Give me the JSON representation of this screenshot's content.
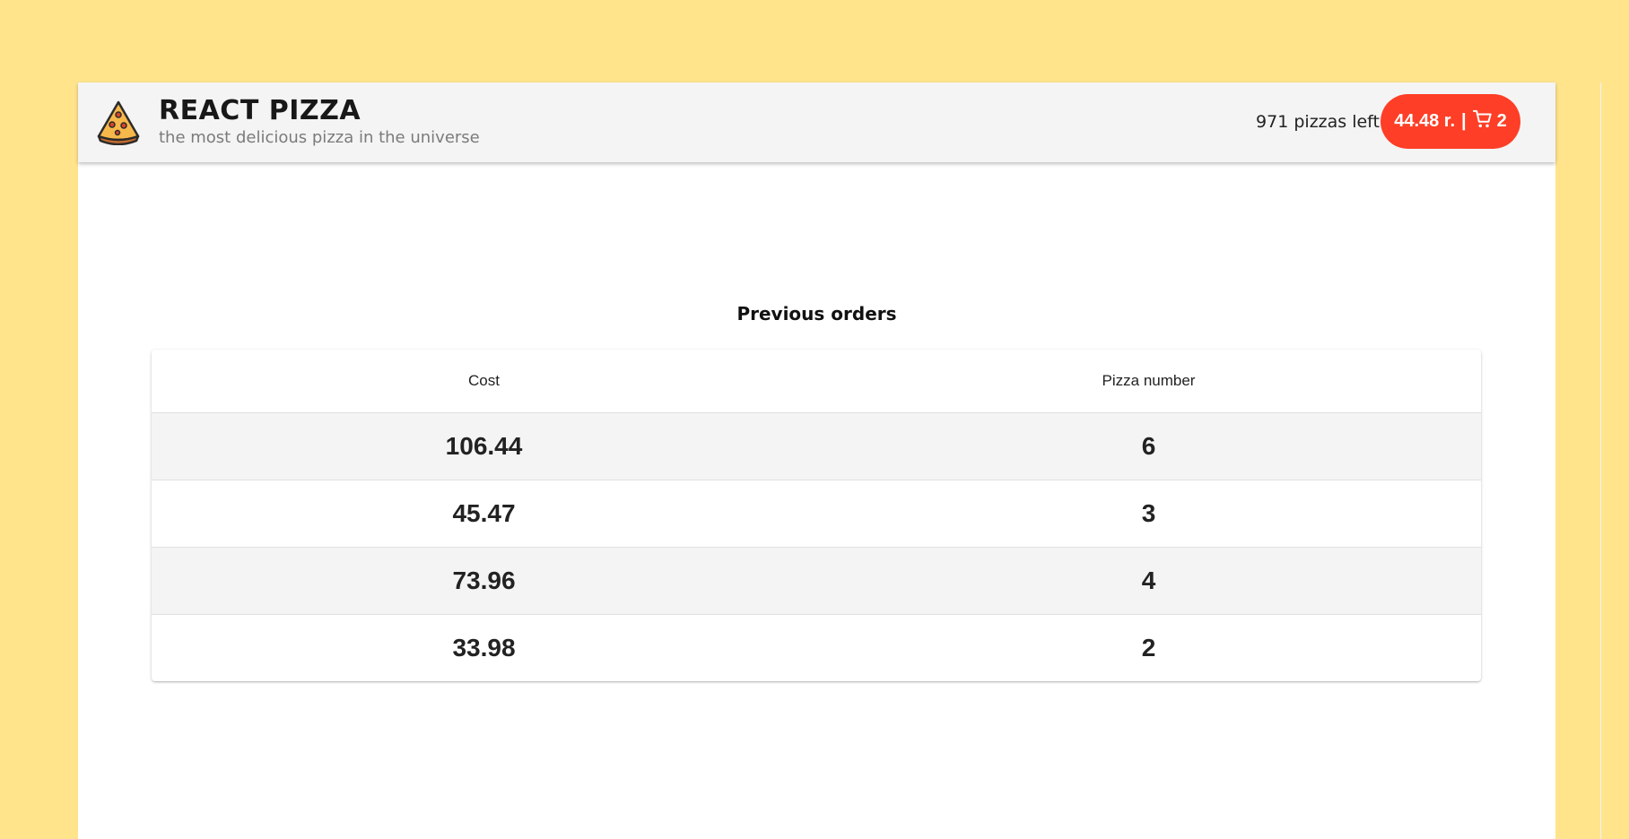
{
  "header": {
    "title": "REACT PIZZA",
    "subtitle": "the most delicious pizza in the universe",
    "stock_text": "971 pizzas left",
    "logo_icon": "pizza-slice-icon"
  },
  "cart": {
    "price": "44.48 r.",
    "separator": "|",
    "icon": "cart-icon",
    "count": "2",
    "color": "#fe3e26"
  },
  "orders": {
    "title": "Previous orders",
    "columns": [
      "Cost",
      "Pizza number"
    ],
    "rows": [
      [
        "106.44",
        "6"
      ],
      [
        "45.47",
        "3"
      ],
      [
        "73.96",
        "4"
      ],
      [
        "33.98",
        "2"
      ]
    ]
  },
  "colors": {
    "background": "#ffe48c",
    "header": "#f4f4f4",
    "accent": "#fe3e26"
  }
}
